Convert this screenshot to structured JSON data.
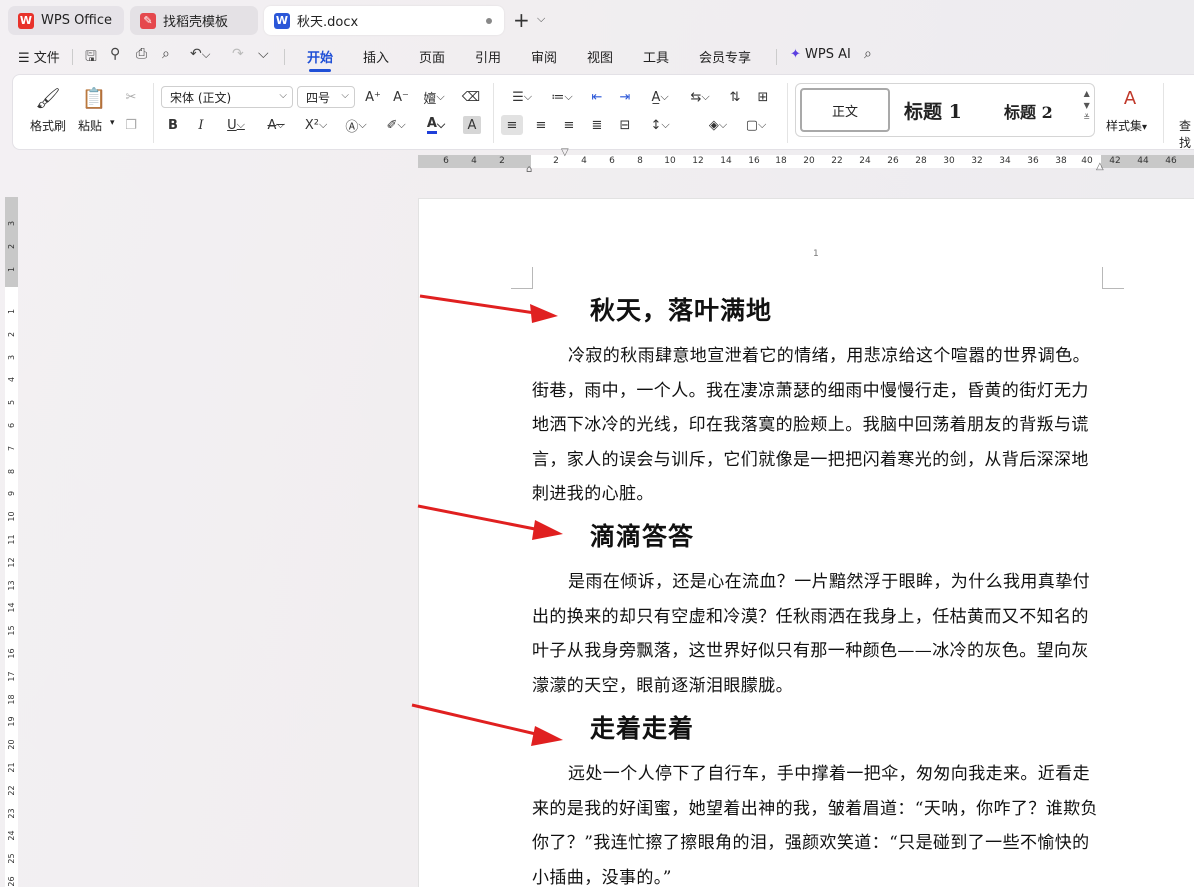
{
  "tabs": [
    {
      "label": "WPS Office",
      "icon": "wps-logo-icon"
    },
    {
      "label": "找稻壳模板",
      "icon": "docer-icon"
    },
    {
      "label": "秋天.docx",
      "icon": "word-doc-icon"
    }
  ],
  "menu": {
    "file": "文件",
    "items": [
      "开始",
      "插入",
      "页面",
      "引用",
      "审阅",
      "视图",
      "工具",
      "会员专享"
    ],
    "active": "开始",
    "ai": "WPS AI"
  },
  "ribbon": {
    "format_painter": "格式刷",
    "paste": "粘贴",
    "font_name": "宋体 (正文)",
    "font_size": "四号",
    "styles": {
      "normal": "正文",
      "h1": "标题 1",
      "h2": "标题 2"
    },
    "style_set": "样式集",
    "find": "查找",
    "colors": {
      "font_color": "#1f3fd9",
      "accent": "#1f4fd6"
    }
  },
  "ruler": {
    "h_numbers": [
      "6",
      "4",
      "2",
      "2",
      "4",
      "6",
      "8",
      "10",
      "12",
      "14",
      "16",
      "18",
      "20",
      "22",
      "24",
      "26",
      "28",
      "30",
      "32",
      "34",
      "36",
      "38",
      "40",
      "42",
      "44",
      "46"
    ],
    "v_numbers_top": [
      "3",
      "2",
      "1"
    ],
    "v_numbers": [
      "1",
      "2",
      "3",
      "4",
      "5",
      "6",
      "7",
      "8",
      "9",
      "10",
      "11",
      "12",
      "13",
      "14",
      "15",
      "16",
      "17",
      "18",
      "19",
      "20",
      "21",
      "22",
      "23",
      "24",
      "25",
      "26"
    ]
  },
  "document": {
    "page_number": "1",
    "sections": [
      {
        "heading": "秋天，落叶满地",
        "body": "冷寂的秋雨肆意地宣泄着它的情绪，用悲凉给这个喧嚣的世界调色。街巷，雨中，一个人。我在凄凉萧瑟的细雨中慢慢行走，昏黄的街灯无力地洒下冰冷的光线，印在我落寞的脸颊上。我脑中回荡着朋友的背叛与谎言，家人的误会与训斥，它们就像是一把把闪着寒光的剑，从背后深深地刺进我的心脏。"
      },
      {
        "heading": "滴滴答答",
        "body": "是雨在倾诉，还是心在流血？一片黯然浮于眼眸，为什么我用真挚付出的换来的却只有空虚和冷漠？任秋雨洒在我身上，任枯黄而又不知名的叶子从我身旁飘落，这世界好似只有那一种颜色——冰冷的灰色。望向灰濛濛的天空，眼前逐渐泪眼朦胧。"
      },
      {
        "heading": "走着走着",
        "body": "远处一个人停下了自行车，手中撑着一把伞，匆匆向我走来。近看走来的是我的好闺蜜，她望着出神的我，皱着眉道：“天呐，你咋了？谁欺负你了？”我连忙擦了擦眼角的泪，强颜欢笑道：“只是碰到了一些不愉快的小插曲，没事的。”"
      }
    ],
    "arrow_color": "#e02020"
  }
}
